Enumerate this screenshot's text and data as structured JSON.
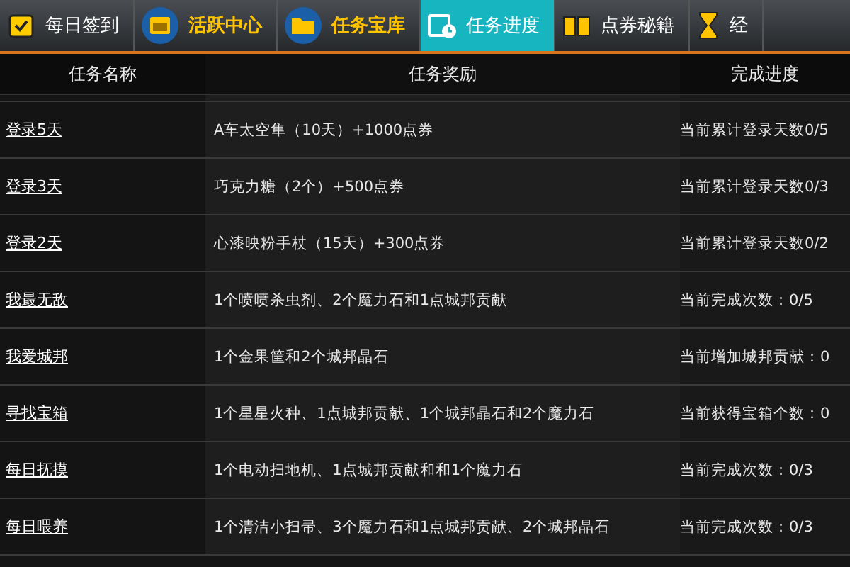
{
  "tabs": [
    {
      "label": "每日签到",
      "kind": "plain",
      "selected": false
    },
    {
      "label": "活跃中心",
      "kind": "featured",
      "selected": false
    },
    {
      "label": "任务宝库",
      "kind": "featured",
      "selected": false
    },
    {
      "label": "任务进度",
      "kind": "plain",
      "selected": true
    },
    {
      "label": "点券秘籍",
      "kind": "plain",
      "selected": false
    },
    {
      "label": "经",
      "kind": "plain",
      "selected": false
    }
  ],
  "table": {
    "columns": [
      "任务名称",
      "任务奖励",
      "完成进度"
    ],
    "rows": [
      {
        "name": "登录5天",
        "reward": "A车太空隼（10天）+1000点券",
        "progress": "当前累计登录天数0/5"
      },
      {
        "name": "登录3天",
        "reward": "巧克力糖（2个）+500点券",
        "progress": "当前累计登录天数0/3"
      },
      {
        "name": "登录2天",
        "reward": "心漆映粉手杖（15天）+300点券",
        "progress": "当前累计登录天数0/2"
      },
      {
        "name": "我最无敌",
        "reward": "1个喷喷杀虫剂、2个魔力石和1点城邦贡献",
        "progress": "当前完成次数：0/5"
      },
      {
        "name": "我爱城邦",
        "reward": "1个金果筐和2个城邦晶石",
        "progress": "当前增加城邦贡献：0"
      },
      {
        "name": "寻找宝箱",
        "reward": "1个星星火种、1点城邦贡献、1个城邦晶石和2个魔力石",
        "progress": "当前获得宝箱个数：0"
      },
      {
        "name": "每日抚摸",
        "reward": "1个电动扫地机、1点城邦贡献和和1个魔力石",
        "progress": "当前完成次数：0/3"
      },
      {
        "name": "每日喂养",
        "reward": "1个清洁小扫帚、3个魔力石和1点城邦贡献、2个城邦晶石",
        "progress": "当前完成次数：0/3"
      }
    ]
  }
}
